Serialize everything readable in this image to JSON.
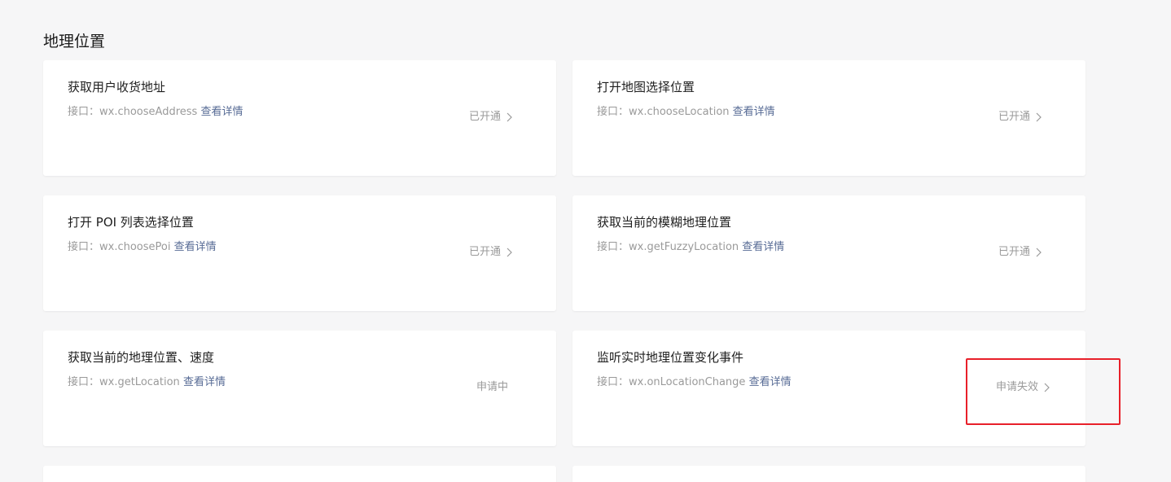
{
  "section": {
    "title": "地理位置"
  },
  "cards": [
    {
      "title": "获取用户收货地址",
      "api_prefix": "接口：wx.chooseAddress",
      "link": "查看详情",
      "status": "已开通",
      "has_arrow": true
    },
    {
      "title": "打开地图选择位置",
      "api_prefix": "接口：wx.chooseLocation",
      "link": "查看详情",
      "status": "已开通",
      "has_arrow": true
    },
    {
      "title": "打开 POI 列表选择位置",
      "api_prefix": "接口：wx.choosePoi",
      "link": "查看详情",
      "status": "已开通",
      "has_arrow": true
    },
    {
      "title": "获取当前的模糊地理位置",
      "api_prefix": "接口：wx.getFuzzyLocation",
      "link": "查看详情",
      "status": "已开通",
      "has_arrow": true
    },
    {
      "title": "获取当前的地理位置、速度",
      "api_prefix": "接口：wx.getLocation",
      "link": "查看详情",
      "status": "申请中",
      "has_arrow": false
    },
    {
      "title": "监听实时地理位置变化事件",
      "api_prefix": "接口：wx.onLocationChange",
      "link": "查看详情",
      "status": "申请失效",
      "has_arrow": true
    }
  ],
  "icons": {
    "arrow": "chevron-right-icon"
  },
  "colors": {
    "link": "#576b95",
    "highlight": "#e8202a",
    "background": "#f6f6f7"
  }
}
